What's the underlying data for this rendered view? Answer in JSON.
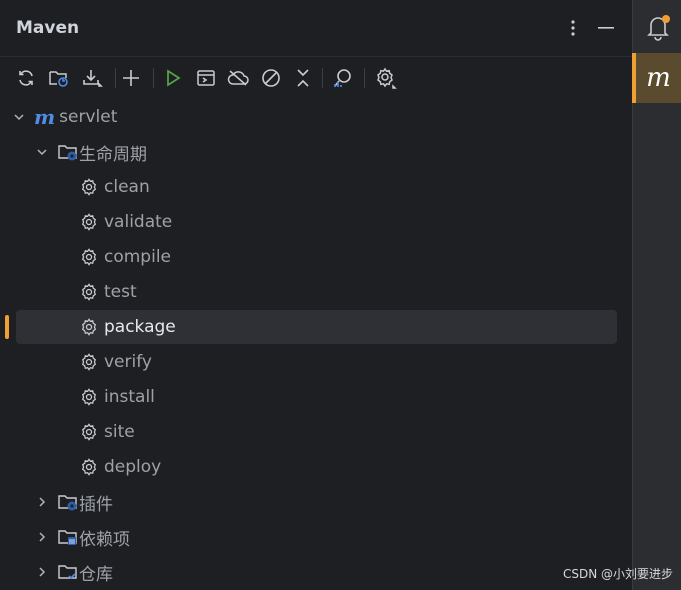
{
  "header": {
    "title": "Maven",
    "more_icon": "vertical-dots-icon",
    "minimize_icon": "minimize-icon"
  },
  "toolbar": [
    {
      "name": "reload-all-projects-button",
      "icon": "sync-icon"
    },
    {
      "name": "generate-sources-button",
      "icon": "folder-refresh-icon"
    },
    {
      "name": "download-sources-button",
      "icon": "download-icon"
    },
    {
      "name": "add-maven-project-button",
      "icon": "plus-icon"
    },
    {
      "name": "run-maven-build-button",
      "icon": "play-icon"
    },
    {
      "name": "execute-maven-goal-button",
      "icon": "terminal-window-icon"
    },
    {
      "name": "toggle-offline-mode-button",
      "icon": "cloud-off-icon"
    },
    {
      "name": "skip-tests-button",
      "icon": "forbidden-icon"
    },
    {
      "name": "collapse-all-button",
      "icon": "collapse-icon"
    },
    {
      "name": "analyze-dependencies-button",
      "icon": "search-analyze-icon"
    },
    {
      "name": "maven-settings-button",
      "icon": "gear-icon"
    }
  ],
  "tree": {
    "project": "servlet",
    "lifecycle": "生命周期",
    "goals": [
      "clean",
      "validate",
      "compile",
      "test",
      "package",
      "verify",
      "install",
      "site",
      "deploy"
    ],
    "selected_goal": "package",
    "plugins": "插件",
    "dependencies": "依赖项",
    "repositories": "仓库"
  },
  "right_strip": {
    "notifications_icon": "bell-icon",
    "maven_tab_label": "m"
  },
  "watermark": "CSDN @小刘要进步",
  "colors": {
    "accent": "#f0a033",
    "maven_blue": "#4f8ee8",
    "run_green": "#57a64a"
  }
}
